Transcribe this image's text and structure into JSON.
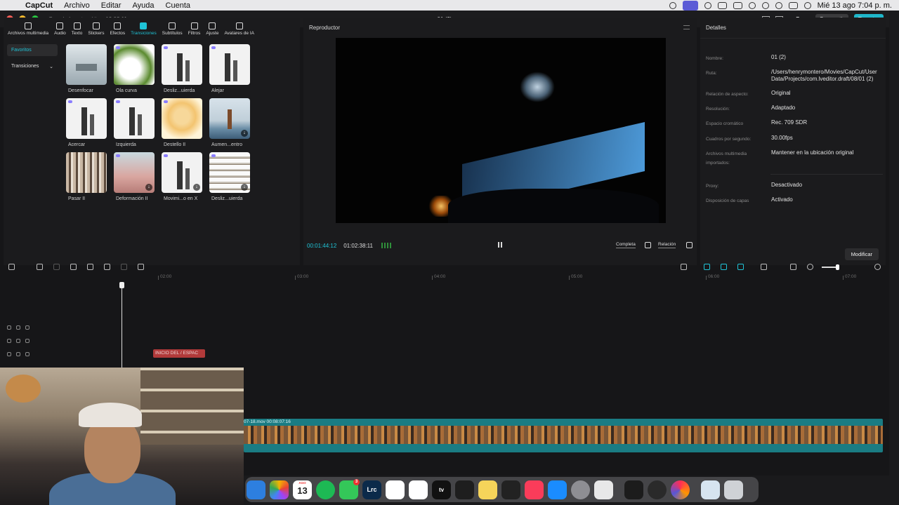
{
  "menubar": {
    "app": "CapCut",
    "menus": [
      "Archivo",
      "Editar",
      "Ayuda",
      "Cuenta"
    ],
    "clock": "Mié 13 ago  7:04 p. m."
  },
  "window": {
    "autosave": "Guardado automático: 19:02:11",
    "title": "01 (2)",
    "pro": "Pro",
    "share": "Compartir",
    "export": "Exportar"
  },
  "toolbar": {
    "items": [
      {
        "label": "Archivos multimedia",
        "icon": "media-icon"
      },
      {
        "label": "Audio",
        "icon": "audio-icon"
      },
      {
        "label": "Texto",
        "icon": "text-icon"
      },
      {
        "label": "Stickers",
        "icon": "sticker-icon"
      },
      {
        "label": "Efectos",
        "icon": "effects-icon"
      },
      {
        "label": "Transiciones",
        "icon": "transitions-icon"
      },
      {
        "label": "Subtítulos",
        "icon": "subtitles-icon"
      },
      {
        "label": "Filtros",
        "icon": "filters-icon"
      },
      {
        "label": "Ajuste",
        "icon": "adjust-icon"
      },
      {
        "label": "Avatares de IA",
        "icon": "avatar-icon"
      }
    ],
    "active": "Transiciones"
  },
  "sidenav": {
    "favorites": "Favoritos",
    "transitions": "Transiciones"
  },
  "transitions": [
    {
      "label": "Desenfocar"
    },
    {
      "label": "Ola curva"
    },
    {
      "label": "Desliz...uierda"
    },
    {
      "label": "Alejar"
    },
    {
      "label": "Acercar"
    },
    {
      "label": "Izquierda"
    },
    {
      "label": "Destello II"
    },
    {
      "label": "Aumen...entro"
    },
    {
      "label": "Pasar II"
    },
    {
      "label": "Deformación II"
    },
    {
      "label": "Movimi...o en X"
    },
    {
      "label": "Desliz...uierda"
    }
  ],
  "player": {
    "title": "Reproductor",
    "current_time": "00:01:44:12",
    "duration": "01:02:38:11",
    "full": "Completa",
    "ratio": "Relación"
  },
  "details": {
    "title": "Detalles",
    "rows": [
      {
        "key": "Nombre:",
        "value": "01 (2)"
      },
      {
        "key": "Ruta:",
        "value": "/Users/henrymontero/Movies/CapCut/User Data/Projects/com.lveditor.draft/08/01 (2)"
      },
      {
        "key": "Relación de aspecto:",
        "value": "Original"
      },
      {
        "key": "Resolución:",
        "value": "Adaptado"
      },
      {
        "key": "Espacio cromático",
        "value": "Rec. 709 SDR"
      },
      {
        "key": "Cuadros por segundo:",
        "value": "30.00fps"
      },
      {
        "key": "Archivos multimedia importados:",
        "value": "Mantener en la ubicación original"
      },
      {
        "key": "Proxy:",
        "value": "Desactivado"
      },
      {
        "key": "Disposición de capas",
        "value": "Activado"
      }
    ],
    "modify": "Modificar"
  },
  "timeline": {
    "ruler": [
      "02:00",
      "03:00",
      "04:00",
      "05:00",
      "06:00",
      "07:00"
    ],
    "text_clip": "INICIO DEL / ESPAC",
    "main_clip": "07-18.mov  00:08:07:16"
  },
  "dock": {
    "calendar_month": "AGO",
    "calendar_day": "13",
    "lrc": "Lrc",
    "appletv": "tv",
    "badge": "3"
  }
}
